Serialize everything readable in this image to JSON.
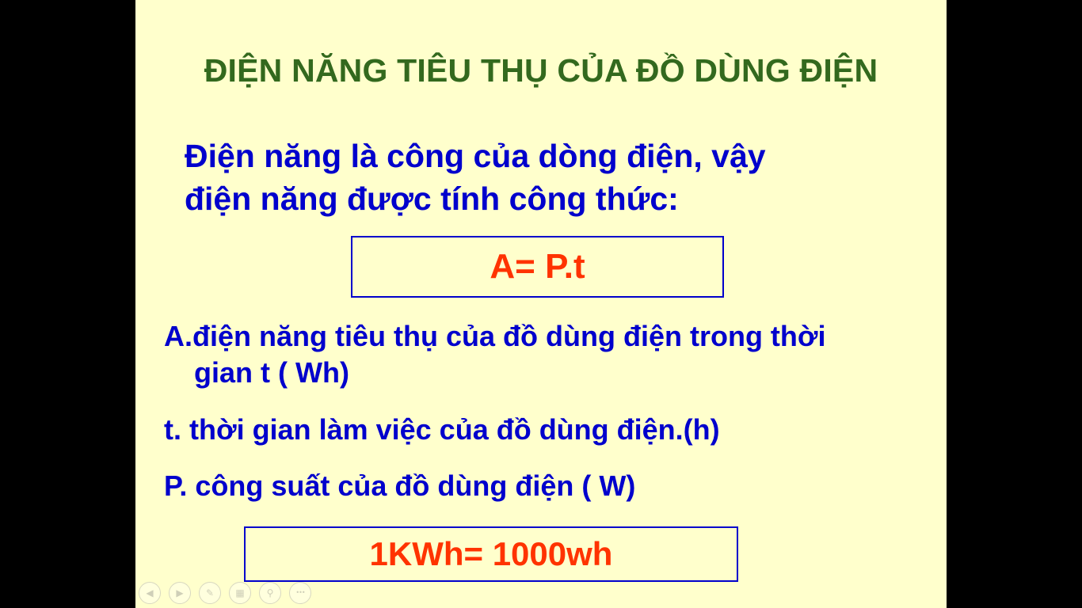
{
  "slide": {
    "title": "ĐIỆN NĂNG TIÊU THỤ CỦA ĐỒ DÙNG ĐIỆN",
    "intro_line1": "Điện năng là công của dòng điện, vậy",
    "intro_line2": "điện năng được tính công thức:",
    "formula": "A= P.t",
    "def_a_line1": "A.điện năng tiêu thụ của đồ dùng điện trong thời",
    "def_a_line2": "gian t ( Wh)",
    "def_t": "t. thời gian làm việc của đồ dùng điện.(h)",
    "def_p": "P. công suất của đồ dùng điện ( W)",
    "unit_conversion": "1KWh= 1000wh"
  },
  "controls": {
    "prev": "◀",
    "next": "▶",
    "pen": "✎",
    "slides": "▦",
    "zoom": "⚲",
    "more": "•••"
  },
  "colors": {
    "background": "#FFFFCC",
    "title": "#33691E",
    "text": "#0000CC",
    "formula": "#FF3300"
  }
}
